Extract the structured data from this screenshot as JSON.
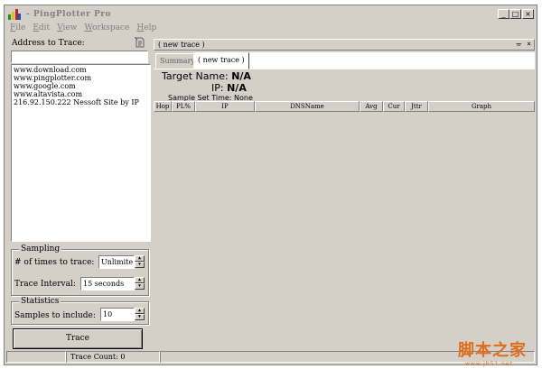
{
  "window": {
    "title": "- PingPlotter Pro",
    "min_glyph": "_",
    "max_glyph": "□",
    "close_glyph": "×"
  },
  "menu": [
    "File",
    "Edit",
    "View",
    "Workspace",
    "Help"
  ],
  "left": {
    "address_label": "Address to Trace:",
    "address_value": "",
    "history": [
      "www.download.com",
      "www.pingplotter.com",
      "www.google.com",
      "www.altavista.com",
      "216.92.150.222 Nessoft Site by IP"
    ],
    "sampling": {
      "title": "Sampling",
      "times_label": "# of times to trace:",
      "times_value": "Unlimite",
      "interval_label": "Trace Interval:",
      "interval_value": "15 seconds"
    },
    "statistics": {
      "title": "Statistics",
      "samples_label": "Samples to include:",
      "samples_value": "10"
    },
    "trace_button": "Trace"
  },
  "document": {
    "title": "( new trace )",
    "pin_glyph": "ᚚ",
    "close_glyph": "×",
    "tabs": [
      "Summary",
      "( new trace )"
    ]
  },
  "info": {
    "target_label": "Target Name:",
    "target_value": "N/A",
    "ip_label": "IP:",
    "ip_value": "N/A",
    "sample_label": "Sample Set Time:",
    "sample_value": "None"
  },
  "columns": [
    "Hop",
    "PL%",
    "IP",
    "DNSName",
    "Avg",
    "Cur",
    "Jttr",
    "Graph"
  ],
  "status": {
    "trace_count": "Trace Count: 0"
  },
  "watermark": {
    "main": "脚本之家",
    "sub": "www.jb51.net"
  },
  "colors": {
    "face": "#d4d0c8",
    "watermark": "#e06d1a"
  }
}
